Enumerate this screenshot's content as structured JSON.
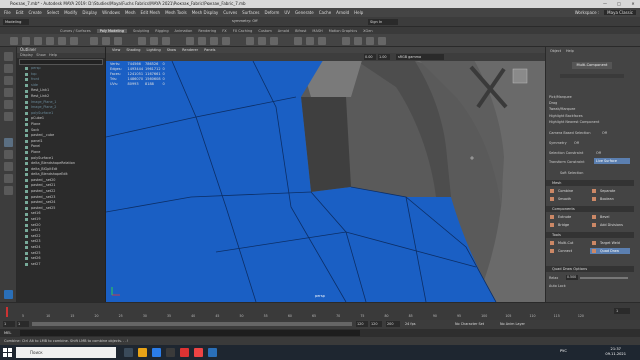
{
  "window": {
    "title": "Рюкзак_7.mb* - Autodesk MAYA 2019: D:\\Studies\\Maya\\Fuchs Fabrics\\MAYA 2021\\Рюкзак_Fabric\\Рюкзак_Fabric_7.mb"
  },
  "menubar": {
    "items": [
      "File",
      "Edit",
      "Create",
      "Select",
      "Modify",
      "Display",
      "Windows",
      "Mesh",
      "Edit Mesh",
      "Mesh Tools",
      "Mesh Display",
      "Curves",
      "Surfaces",
      "Deform",
      "UV",
      "Generate",
      "Cache",
      "Arnold",
      "Help"
    ],
    "workspace_label": "Workspace :",
    "workspace_value": "Maya Classic"
  },
  "statusline": {
    "mode": "Modeling",
    "symmetry": "symmetry: Off",
    "sign_in": "Sign In"
  },
  "shelf": {
    "tabs": [
      "Curves / Surfaces",
      "Poly Modeling",
      "Sculpting",
      "Rigging",
      "Animation",
      "Rendering",
      "FX",
      "FX Caching",
      "Custom",
      "Arnold",
      "Bifrost",
      "MASH",
      "Motion Graphics",
      "XGen"
    ],
    "active_tab": "Poly Modeling"
  },
  "outliner": {
    "title": "Outliner",
    "menu": [
      "Display",
      "Show",
      "Help"
    ],
    "items": [
      {
        "label": "persp",
        "dim": true
      },
      {
        "label": "top",
        "dim": true
      },
      {
        "label": "front",
        "dim": true
      },
      {
        "label": "side",
        "dim": true
      },
      {
        "label": "Rest_Link1",
        "dim": false
      },
      {
        "label": "Rest_Link2",
        "dim": false
      },
      {
        "label": "Image_Plane_1",
        "dim": true
      },
      {
        "label": "Image_Plane_2",
        "dim": true
      },
      {
        "label": "polySurface1",
        "dim": true
      },
      {
        "label": "pCube1",
        "dim": false
      },
      {
        "label": "Plane",
        "dim": false
      },
      {
        "label": "Sock",
        "dim": false
      },
      {
        "label": "pasted__cube",
        "dim": false
      },
      {
        "label": "panel1",
        "dim": false
      },
      {
        "label": "Panel",
        "dim": false
      },
      {
        "label": "Plane",
        "dim": false
      },
      {
        "label": "polySurface1",
        "dim": false
      },
      {
        "label": "delta_BlendshapeRelation",
        "dim": false
      },
      {
        "label": "delta_BlGpltEdt",
        "dim": false
      },
      {
        "label": "delta_BlendshapeEdit",
        "dim": false
      },
      {
        "label": "pasted__set20",
        "dim": false
      },
      {
        "label": "pasted__set21",
        "dim": false
      },
      {
        "label": "pasted__set22",
        "dim": false
      },
      {
        "label": "pasted__set23",
        "dim": false
      },
      {
        "label": "pasted__set24",
        "dim": false
      },
      {
        "label": "pasted__set25",
        "dim": false
      },
      {
        "label": "set16",
        "dim": false
      },
      {
        "label": "set19",
        "dim": false
      },
      {
        "label": "set20",
        "dim": false
      },
      {
        "label": "set21",
        "dim": false
      },
      {
        "label": "set22",
        "dim": false
      },
      {
        "label": "set23",
        "dim": false
      },
      {
        "label": "set24",
        "dim": false
      },
      {
        "label": "set25",
        "dim": false
      },
      {
        "label": "set26",
        "dim": false
      },
      {
        "label": "set27",
        "dim": false
      }
    ]
  },
  "viewport": {
    "menu": [
      "View",
      "Shading",
      "Lighting",
      "Show",
      "Renderer",
      "Panels"
    ],
    "camera_label": "persp",
    "near_value": "0.00",
    "far_value": "1.00",
    "color_space": "sRGB gamma",
    "hud": {
      "rows": [
        {
          "label": "Verts:",
          "a": "744566",
          "b": "786526",
          "c": "0"
        },
        {
          "label": "Edges:",
          "a": "1493444",
          "b": "1961712",
          "c": "0"
        },
        {
          "label": "Faces:",
          "a": "1241051",
          "b": "1167661",
          "c": "0"
        },
        {
          "label": "Tris:",
          "a": "1486070",
          "b": "1560608",
          "c": "0"
        },
        {
          "label": "UVs:",
          "a": "80993",
          "b": "8188",
          "c": "0"
        }
      ]
    },
    "colors": {
      "selection_blue": "#1a5fc4",
      "mesh_grey": "#6b6b6b"
    }
  },
  "attribute_panel": {
    "menu": [
      "Object",
      "Help"
    ],
    "multi_component": "Multi-Component",
    "pick_marquee": "Pick/Marquee",
    "drag": "Drag",
    "tweak_marquee": "Tweak/Marquee",
    "highlight_backfaces": "Highlight Backfaces",
    "highlight_nearest": "Highlight Nearest Component",
    "camera_based": "Camera Based Selection",
    "camera_based_val": "Off",
    "symmetry": "Symmetry",
    "symmetry_val": "Off",
    "sel_constraint": "Selection Constraint",
    "sel_constraint_val": "Off",
    "transform_constraint": "Transform Constraint",
    "transform_constraint_val": "Live Surface",
    "soft_selection": "Soft Selection",
    "sections": {
      "mesh": "Mesh",
      "components": "Components",
      "tools": "Tools",
      "quad_draw": "Quad Draw Options"
    },
    "mesh_buttons": [
      "Combine",
      "Separate",
      "Smooth",
      "Boolean"
    ],
    "component_buttons": [
      "Extrude",
      "Bevel",
      "Bridge",
      "Add Divisions"
    ],
    "tool_buttons": [
      "Multi-Cut",
      "Target Weld",
      "Connect",
      "Quad Draw"
    ],
    "relax_label": "Relax",
    "auto_lock": "Auto Lock",
    "relax_value": "0.500"
  },
  "timeline": {
    "ticks": [
      "5",
      "10",
      "15",
      "20",
      "25",
      "30",
      "35",
      "40",
      "45",
      "50",
      "55",
      "60",
      "65",
      "70",
      "75",
      "80",
      "85",
      "90",
      "95",
      "100",
      "105",
      "110",
      "115",
      "120"
    ],
    "current_frame": "1",
    "start": "1",
    "end": "120",
    "range_start": "1",
    "range_end": "120",
    "range_far": "200",
    "fps": "24 fps",
    "no_character_set": "No Character Set",
    "no_anim_layer": "No Anim Layer"
  },
  "cmdline": {
    "label": "MEL"
  },
  "helpline": {
    "text": "Combine: Ctrl Alt to LMB to combine. Shift LMB to combine objects. . .!"
  },
  "taskbar": {
    "search_placeholder": "Поиск",
    "time": "21:37",
    "date": "09.11.2021",
    "lang": "РУС"
  }
}
